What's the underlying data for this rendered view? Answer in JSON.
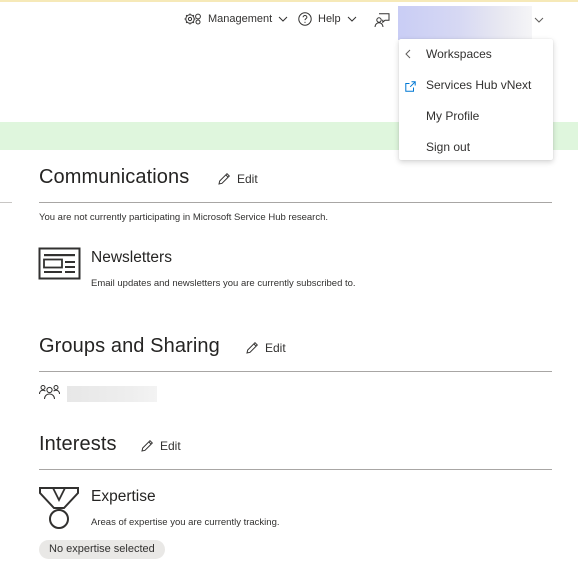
{
  "header": {
    "management_label": "Management",
    "help_label": "Help"
  },
  "menu": {
    "items": [
      {
        "label": "Workspaces",
        "icon": "chevron-left-icon"
      },
      {
        "label": "Services Hub vNext",
        "icon": "external-link-icon"
      },
      {
        "label": "My Profile",
        "icon": ""
      },
      {
        "label": "Sign out",
        "icon": ""
      }
    ]
  },
  "communications": {
    "title": "Communications",
    "edit_label": "Edit",
    "research_text": "You are not currently participating in Microsoft Service Hub research.",
    "newsletters_title": "Newsletters",
    "newsletters_desc": "Email updates and newsletters you are currently subscribed to."
  },
  "groups": {
    "title": "Groups and Sharing",
    "edit_label": "Edit"
  },
  "interests": {
    "title": "Interests",
    "edit_label": "Edit",
    "expertise_title": "Expertise",
    "expertise_desc": "Areas of expertise you are currently tracking.",
    "expertise_chip": "No expertise selected"
  },
  "colors": {
    "banner_green": "#dff6dd",
    "text": "#252423",
    "link_blue": "#0078d4"
  }
}
